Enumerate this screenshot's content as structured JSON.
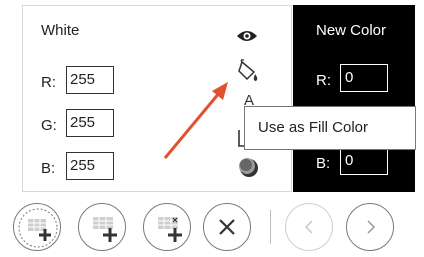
{
  "current": {
    "name": "White",
    "r_label": "R:",
    "r_value": "255",
    "g_label": "G:",
    "g_value": "255",
    "b_label": "B:",
    "b_value": "255"
  },
  "new_color": {
    "title": "New Color",
    "r_label": "R:",
    "r_value": "0",
    "b_label": "B:",
    "b_value": "0"
  },
  "tools": {
    "text_a": "A",
    "tooltip": "Use as Fill Color"
  },
  "icons": [
    "eye-icon",
    "paint-bucket-icon",
    "text-color-icon",
    "border-color-icon",
    "shadow-color-icon",
    "add-grid-icon",
    "add-color-icon",
    "replace-color-icon",
    "close-icon",
    "chevron-left-icon",
    "chevron-right-icon"
  ],
  "colors": {
    "new_color_swatch": "#000000",
    "arrow": "#e0522f"
  }
}
